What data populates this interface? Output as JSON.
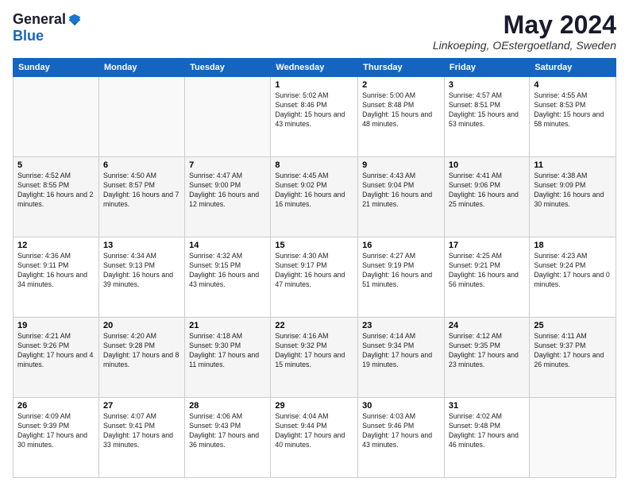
{
  "logo": {
    "general": "General",
    "blue": "Blue"
  },
  "title": "May 2024",
  "location": "Linkoeping, OEstergoetland, Sweden",
  "days_header": [
    "Sunday",
    "Monday",
    "Tuesday",
    "Wednesday",
    "Thursday",
    "Friday",
    "Saturday"
  ],
  "weeks": [
    [
      {
        "day": "",
        "info": ""
      },
      {
        "day": "",
        "info": ""
      },
      {
        "day": "",
        "info": ""
      },
      {
        "day": "1",
        "info": "Sunrise: 5:02 AM\nSunset: 8:46 PM\nDaylight: 15 hours\nand 43 minutes."
      },
      {
        "day": "2",
        "info": "Sunrise: 5:00 AM\nSunset: 8:48 PM\nDaylight: 15 hours\nand 48 minutes."
      },
      {
        "day": "3",
        "info": "Sunrise: 4:57 AM\nSunset: 8:51 PM\nDaylight: 15 hours\nand 53 minutes."
      },
      {
        "day": "4",
        "info": "Sunrise: 4:55 AM\nSunset: 8:53 PM\nDaylight: 15 hours\nand 58 minutes."
      }
    ],
    [
      {
        "day": "5",
        "info": "Sunrise: 4:52 AM\nSunset: 8:55 PM\nDaylight: 16 hours\nand 2 minutes."
      },
      {
        "day": "6",
        "info": "Sunrise: 4:50 AM\nSunset: 8:57 PM\nDaylight: 16 hours\nand 7 minutes."
      },
      {
        "day": "7",
        "info": "Sunrise: 4:47 AM\nSunset: 9:00 PM\nDaylight: 16 hours\nand 12 minutes."
      },
      {
        "day": "8",
        "info": "Sunrise: 4:45 AM\nSunset: 9:02 PM\nDaylight: 16 hours\nand 16 minutes."
      },
      {
        "day": "9",
        "info": "Sunrise: 4:43 AM\nSunset: 9:04 PM\nDaylight: 16 hours\nand 21 minutes."
      },
      {
        "day": "10",
        "info": "Sunrise: 4:41 AM\nSunset: 9:06 PM\nDaylight: 16 hours\nand 25 minutes."
      },
      {
        "day": "11",
        "info": "Sunrise: 4:38 AM\nSunset: 9:09 PM\nDaylight: 16 hours\nand 30 minutes."
      }
    ],
    [
      {
        "day": "12",
        "info": "Sunrise: 4:36 AM\nSunset: 9:11 PM\nDaylight: 16 hours\nand 34 minutes."
      },
      {
        "day": "13",
        "info": "Sunrise: 4:34 AM\nSunset: 9:13 PM\nDaylight: 16 hours\nand 39 minutes."
      },
      {
        "day": "14",
        "info": "Sunrise: 4:32 AM\nSunset: 9:15 PM\nDaylight: 16 hours\nand 43 minutes."
      },
      {
        "day": "15",
        "info": "Sunrise: 4:30 AM\nSunset: 9:17 PM\nDaylight: 16 hours\nand 47 minutes."
      },
      {
        "day": "16",
        "info": "Sunrise: 4:27 AM\nSunset: 9:19 PM\nDaylight: 16 hours\nand 51 minutes."
      },
      {
        "day": "17",
        "info": "Sunrise: 4:25 AM\nSunset: 9:21 PM\nDaylight: 16 hours\nand 56 minutes."
      },
      {
        "day": "18",
        "info": "Sunrise: 4:23 AM\nSunset: 9:24 PM\nDaylight: 17 hours\nand 0 minutes."
      }
    ],
    [
      {
        "day": "19",
        "info": "Sunrise: 4:21 AM\nSunset: 9:26 PM\nDaylight: 17 hours\nand 4 minutes."
      },
      {
        "day": "20",
        "info": "Sunrise: 4:20 AM\nSunset: 9:28 PM\nDaylight: 17 hours\nand 8 minutes."
      },
      {
        "day": "21",
        "info": "Sunrise: 4:18 AM\nSunset: 9:30 PM\nDaylight: 17 hours\nand 11 minutes."
      },
      {
        "day": "22",
        "info": "Sunrise: 4:16 AM\nSunset: 9:32 PM\nDaylight: 17 hours\nand 15 minutes."
      },
      {
        "day": "23",
        "info": "Sunrise: 4:14 AM\nSunset: 9:34 PM\nDaylight: 17 hours\nand 19 minutes."
      },
      {
        "day": "24",
        "info": "Sunrise: 4:12 AM\nSunset: 9:35 PM\nDaylight: 17 hours\nand 23 minutes."
      },
      {
        "day": "25",
        "info": "Sunrise: 4:11 AM\nSunset: 9:37 PM\nDaylight: 17 hours\nand 26 minutes."
      }
    ],
    [
      {
        "day": "26",
        "info": "Sunrise: 4:09 AM\nSunset: 9:39 PM\nDaylight: 17 hours\nand 30 minutes."
      },
      {
        "day": "27",
        "info": "Sunrise: 4:07 AM\nSunset: 9:41 PM\nDaylight: 17 hours\nand 33 minutes."
      },
      {
        "day": "28",
        "info": "Sunrise: 4:06 AM\nSunset: 9:43 PM\nDaylight: 17 hours\nand 36 minutes."
      },
      {
        "day": "29",
        "info": "Sunrise: 4:04 AM\nSunset: 9:44 PM\nDaylight: 17 hours\nand 40 minutes."
      },
      {
        "day": "30",
        "info": "Sunrise: 4:03 AM\nSunset: 9:46 PM\nDaylight: 17 hours\nand 43 minutes."
      },
      {
        "day": "31",
        "info": "Sunrise: 4:02 AM\nSunset: 9:48 PM\nDaylight: 17 hours\nand 46 minutes."
      },
      {
        "day": "",
        "info": ""
      }
    ]
  ]
}
